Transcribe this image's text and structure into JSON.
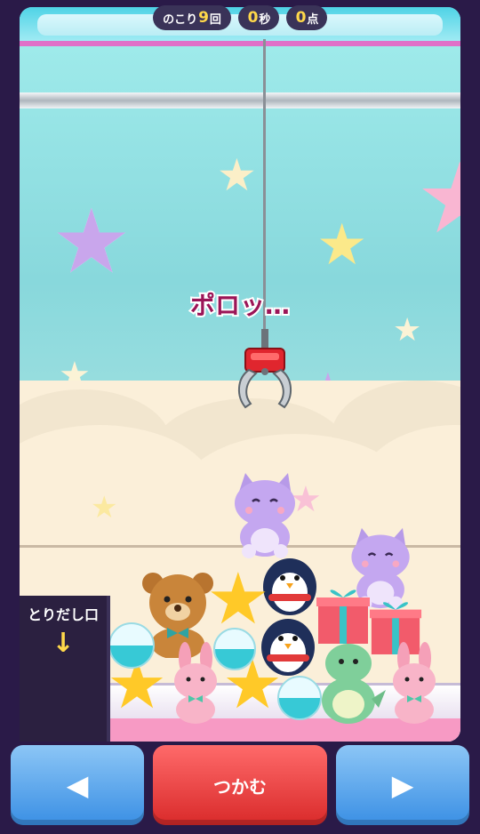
{
  "hud": {
    "remaining_prefix": "のこり",
    "remaining_count": "9",
    "remaining_suffix": "回",
    "seconds_value": "0",
    "seconds_unit": "秒",
    "score_value": "0",
    "score_unit": "点"
  },
  "message": "ポロッ…",
  "chute": {
    "label": "とりだし口",
    "arrow": "↓"
  },
  "controls": {
    "left_label": "◀",
    "grab_label": "つかむ",
    "right_label": "▶"
  },
  "prizes": [
    "cat",
    "cat",
    "penguin",
    "penguin",
    "bear",
    "star",
    "star",
    "star",
    "bunny",
    "bunny",
    "dinosaur",
    "gift",
    "gift",
    "capsule",
    "capsule",
    "capsule"
  ],
  "colors": {
    "grab_button": "#e23a3a",
    "move_button": "#4a9be8",
    "hud_bg": "#3a3358",
    "hud_number": "#ffd84a",
    "message": "#9b1557"
  }
}
